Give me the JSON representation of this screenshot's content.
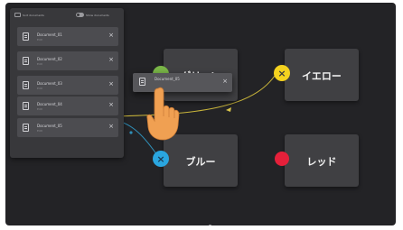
{
  "panel": {
    "header_left_label": "Sort documents",
    "header_right_label": "Show documents",
    "documents": [
      {
        "name": "Document_01",
        "subtitle": "Edit",
        "close": "×"
      },
      {
        "name": "Document_02",
        "subtitle": "Edit",
        "close": "×"
      },
      {
        "name": "Document_03",
        "subtitle": "Edit",
        "close": "×"
      },
      {
        "name": "Document_04",
        "subtitle": "Edit",
        "close": "×"
      },
      {
        "name": "Document_05",
        "subtitle": "Edit",
        "close": "×"
      }
    ]
  },
  "dragged_document": {
    "name": "Document_05",
    "close": "×"
  },
  "nodes": {
    "green": {
      "label": "グリーン",
      "color": "#7ab648"
    },
    "yellow": {
      "label": "イエロー",
      "color": "#f4d21f",
      "port_symbol": "×"
    },
    "blue": {
      "label": "ブルー",
      "color": "#2aa6e0",
      "port_symbol": "×"
    },
    "red": {
      "label": "レッド",
      "color": "#e5203a"
    }
  },
  "wire_colors": {
    "yellow": "#c8b43a",
    "blue": "#2f8fb8"
  }
}
